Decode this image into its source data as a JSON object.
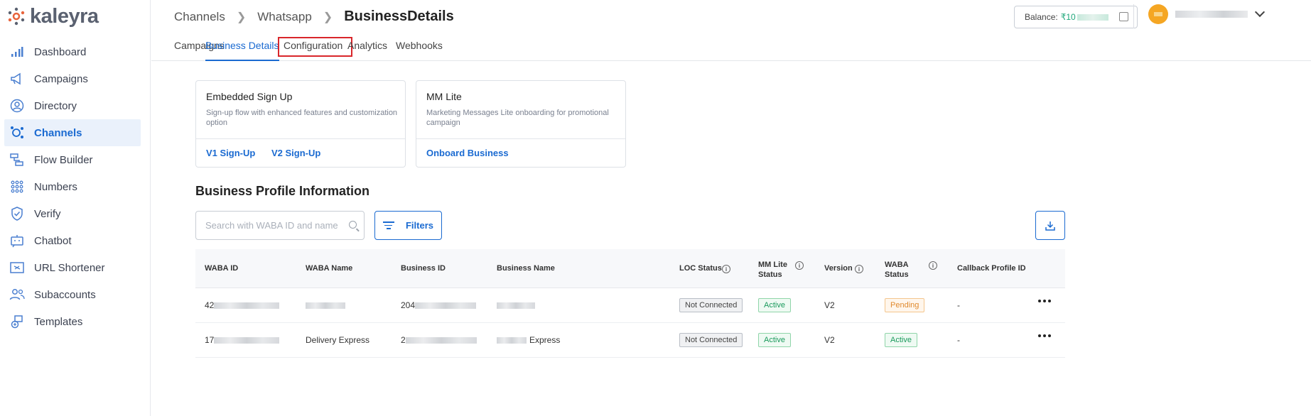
{
  "logo": {
    "text": "kaleyra"
  },
  "sidebar": {
    "items": [
      {
        "label": "Dashboard",
        "icon": "bar-chart-icon",
        "active": false
      },
      {
        "label": "Campaigns",
        "icon": "megaphone-icon",
        "active": false
      },
      {
        "label": "Directory",
        "icon": "user-circle-icon",
        "active": false
      },
      {
        "label": "Channels",
        "icon": "channels-icon",
        "active": true
      },
      {
        "label": "Flow Builder",
        "icon": "flow-icon",
        "active": false
      },
      {
        "label": "Numbers",
        "icon": "dial-pad-icon",
        "active": false
      },
      {
        "label": "Verify",
        "icon": "shield-icon",
        "active": false
      },
      {
        "label": "Chatbot",
        "icon": "chatbot-icon",
        "active": false
      },
      {
        "label": "URL Shortener",
        "icon": "link-icon",
        "active": false
      },
      {
        "label": "Subaccounts",
        "icon": "users-icon",
        "active": false
      },
      {
        "label": "Templates",
        "icon": "templates-icon",
        "active": false
      }
    ]
  },
  "breadcrumb": {
    "items": [
      "Channels",
      "Whatsapp"
    ],
    "current": "BusinessDetails"
  },
  "balance": {
    "label": "Balance:",
    "amount": "₹10"
  },
  "tabs": [
    {
      "label": "Campaigns",
      "state": "normal"
    },
    {
      "label": "Business Details",
      "state": "active"
    },
    {
      "label": "Configuration",
      "state": "highlighted"
    },
    {
      "label": "Analytics",
      "state": "normal"
    },
    {
      "label": "Webhooks",
      "state": "normal"
    }
  ],
  "cards": {
    "embedded": {
      "title": "Embedded Sign Up",
      "desc": "Sign-up flow with enhanced features and customization option",
      "link1": "V1 Sign-Up",
      "link2": "V2 Sign-Up"
    },
    "mmlite": {
      "title": "MM Lite",
      "desc": "Marketing Messages Lite onboarding for promotional campaign",
      "link1": "Onboard Business"
    }
  },
  "section_title": "Business Profile Information",
  "search": {
    "placeholder": "Search with WABA ID and name"
  },
  "filters_label": "Filters",
  "table": {
    "headers": {
      "waba_id": "WABA ID",
      "waba_name": "WABA Name",
      "business_id": "Business ID",
      "business_name": "Business Name",
      "loc_status": "LOC Status",
      "mm_lite_status_1": "MM Lite",
      "mm_lite_status_2": "Status",
      "version": "Version",
      "waba_status_1": "WABA",
      "waba_status_2": "Status",
      "callback": "Callback Profile ID"
    },
    "rows": [
      {
        "waba_id": "42",
        "waba_name": "",
        "business_id": "204",
        "business_name": "",
        "loc_status": "Not Connected",
        "mm_lite": "Active",
        "version": "V2",
        "waba_status": "Pending",
        "callback": "-"
      },
      {
        "waba_id": "17",
        "waba_name": "Delivery Express",
        "business_id": "2",
        "business_name": "Express",
        "loc_status": "Not Connected",
        "mm_lite": "Active",
        "version": "V2",
        "waba_status": "Active",
        "callback": "-"
      }
    ]
  },
  "colors": {
    "accent": "#1a6ad1",
    "highlight_border": "#d9262b",
    "success": "#1a9a5c",
    "warning": "#e08a2e"
  }
}
